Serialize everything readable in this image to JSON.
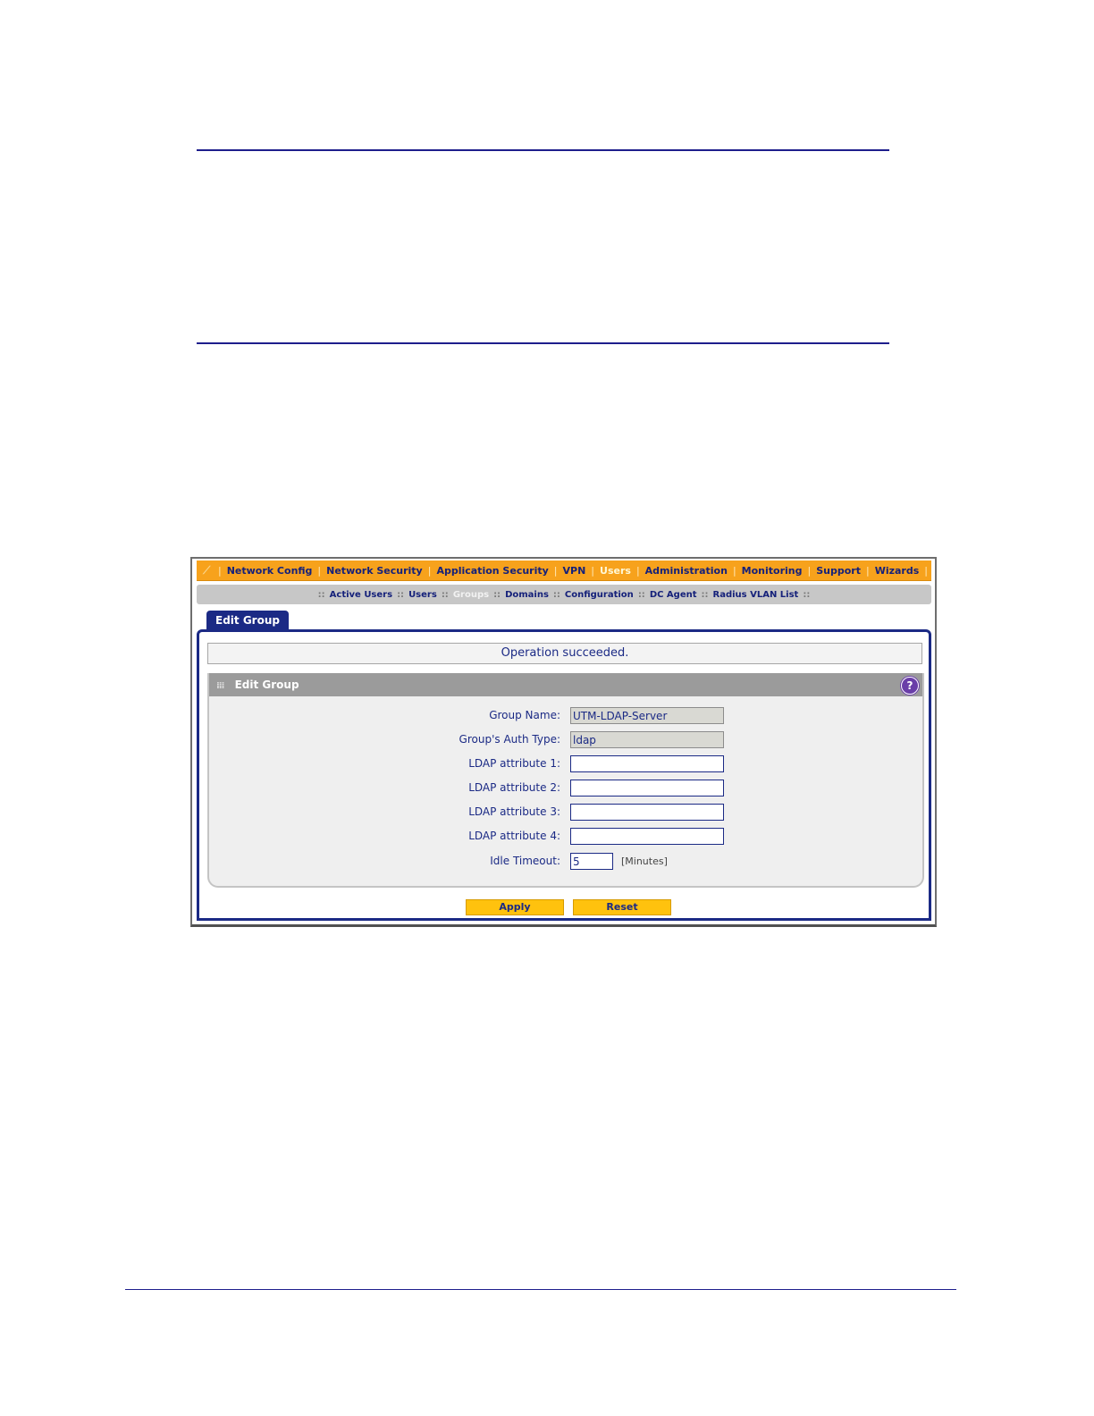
{
  "nav": {
    "items": [
      {
        "label": "Network Config",
        "active": false
      },
      {
        "label": "Network Security",
        "active": false
      },
      {
        "label": "Application Security",
        "active": false
      },
      {
        "label": "VPN",
        "active": false
      },
      {
        "label": "Users",
        "active": true
      },
      {
        "label": "Administration",
        "active": false
      },
      {
        "label": "Monitoring",
        "active": false
      },
      {
        "label": "Support",
        "active": false
      },
      {
        "label": "Wizards",
        "active": false
      }
    ],
    "separator": "|"
  },
  "subnav": {
    "items": [
      {
        "label": "Active Users",
        "active": false
      },
      {
        "label": "Users",
        "active": false
      },
      {
        "label": "Groups",
        "active": true
      },
      {
        "label": "Domains",
        "active": false
      },
      {
        "label": "Configuration",
        "active": false
      },
      {
        "label": "DC Agent",
        "active": false
      },
      {
        "label": "Radius VLAN List",
        "active": false
      }
    ],
    "separator": "::"
  },
  "tab": {
    "label": "Edit Group"
  },
  "status": {
    "message": "Operation succeeded."
  },
  "panel": {
    "title": "Edit Group",
    "help_symbol": "?",
    "fields": [
      {
        "label": "Group Name:",
        "value": "UTM-LDAP-Server",
        "readonly": true
      },
      {
        "label": "Group's Auth Type:",
        "value": "ldap",
        "readonly": true
      },
      {
        "label": "LDAP attribute 1:",
        "value": "",
        "readonly": false
      },
      {
        "label": "LDAP attribute 2:",
        "value": "",
        "readonly": false
      },
      {
        "label": "LDAP attribute 3:",
        "value": "",
        "readonly": false
      },
      {
        "label": "LDAP attribute 4:",
        "value": "",
        "readonly": false
      }
    ],
    "idle_timeout": {
      "label": "Idle Timeout:",
      "value": "5",
      "unit": "[Minutes]"
    }
  },
  "buttons": {
    "apply": "Apply",
    "reset": "Reset"
  },
  "colors": {
    "nav_bar": "#f7a21c",
    "accent": "#1b2a85",
    "button": "#ffc20e",
    "subnav": "#c7c7c7"
  }
}
